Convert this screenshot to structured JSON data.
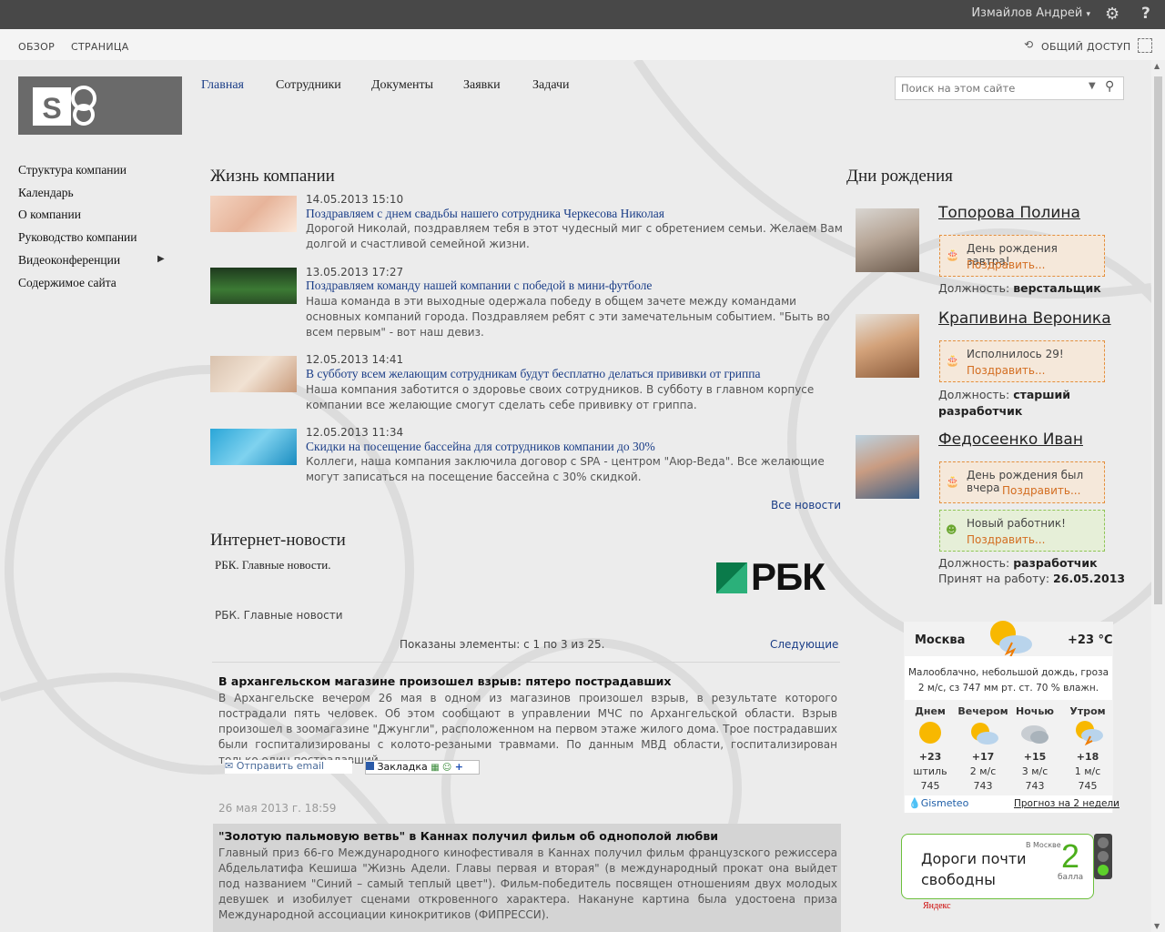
{
  "topbar": {
    "user_name": "Измайлов Андрей",
    "help": "?"
  },
  "ribbon": {
    "tab_browse": "ОБЗОР",
    "tab_page": "СТРАНИЦА",
    "share": "ОБЩИЙ ДОСТУП"
  },
  "topnav": [
    "Главная",
    "Сотрудники",
    "Документы",
    "Заявки",
    "Задачи"
  ],
  "search": {
    "placeholder": "Поиск на этом сайте"
  },
  "leftnav": [
    "Структура компании",
    "Календарь",
    "О компании",
    "Руководство компании",
    "Видеоконференции",
    "Содержимое сайта"
  ],
  "company": {
    "heading": "Жизнь компании",
    "news": [
      {
        "date": "14.05.2013 15:10",
        "title": "Поздравляем с днем свадьбы нашего сотрудника Черкесова Николая",
        "text": "Дорогой Николай, поздравляем тебя в этот чудесный миг с обретением семьи. Желаем Вам долгой и счастливой семейной жизни."
      },
      {
        "date": "13.05.2013 17:27",
        "title": "Поздравляем команду нашей компании с победой в мини-футболе",
        "text": "Наша команда в эти выходные одержала победу в общем зачете между командами основных компаний города. Поздравляем ребят с эти замечательным событием. \"Быть во всем первым\" - вот наш девиз."
      },
      {
        "date": "12.05.2013 14:41",
        "title": "В субботу всем желающим сотрудникам будут бесплатно делаться прививки от гриппа",
        "text": "Наша компания заботится о здоровье своих сотрудников. В субботу в главном корпусе компании все желающие смогут сделать себе прививку от гриппа."
      },
      {
        "date": "12.05.2013 11:34",
        "title": "Скидки на посещение бассейна для сотрудников компании до 30%",
        "text": "Коллеги, наша компания заключила договор с SPA - центром \"Аюр-Веда\". Все желающие могут записаться на посещение бассейна с 30% скидкой."
      }
    ],
    "all_news": "Все новости"
  },
  "internet": {
    "heading": "Интернет-новости",
    "source_title": "РБК. Главные новости.",
    "logo_text": "РБК",
    "feed_name": "РБК. Главные новости",
    "paging": "Показаны элементы: с 1 по 3 из 25.",
    "next": "Следующие",
    "items": [
      {
        "title": "В архангельском магазине произошел взрыв: пятеро пострадавших",
        "text": "В Архангельске вечером 26 мая в одном из магазинов произошел взрыв, в результате которого пострадали пять человек. Об этом сообщают в управлении МЧС по Архангельской области. Взрыв произошел в зоомагазине \"Джунгли\", расположенном на первом этаже жилого дома. Трое пострадавших были госпитализированы с колото-резаными травмами. По данным МВД области, госпитализирован только один пострадавший.",
        "email": "Отправить email",
        "bookmark": "Закладка"
      },
      {
        "date": "26 мая 2013 г. 18:59",
        "title": "\"Золотую пальмовую ветвь\" в Каннах получил фильм об однополой любви",
        "text": "Главный приз 66-го Международного кинофестиваля в Каннах получил фильм французского режиссера Абдельлатифа Кешиша \"Жизнь Адели. Главы первая и вторая\" (в международный прокат она выйдет под названием \"Синий – самый теплый цвет\"). Фильм-победитель посвящен отношениям двух молодых девушек и изобилует сценами откровенного характера. Накануне картина была удостоена приза Международной ассоциации кинокритиков (ФИПРЕССИ)."
      }
    ]
  },
  "birthdays": {
    "heading": "Дни рождения",
    "people": [
      {
        "name": "Топорова Полина",
        "note": "День рождения завтра!",
        "cong": "Поздравить...",
        "pos_label": "Должность:",
        "position": "верстальщик"
      },
      {
        "name": "Крапивина Вероника",
        "note": "Исполнилось 29!",
        "cong": "Поздравить...",
        "pos_label": "Должность:",
        "position": "старший разработчик"
      },
      {
        "name": "Федосеенко Иван",
        "note": "День рождения был вчера",
        "cong": "Поздравить...",
        "note2": "Новый работник!",
        "cong2": "Поздравить...",
        "pos_label": "Должность:",
        "position": "разработчик",
        "hired_label": "Принят на работу:",
        "hired": "26.05.2013"
      }
    ]
  },
  "weather": {
    "city": "Москва",
    "temp": "+23 °C",
    "desc": "Малооблачно, небольшой дождь, гроза",
    "details": "2 м/с, сз  747 мм рт. ст.  70 % влажн.",
    "periods": [
      {
        "name": "Днем",
        "t": "+23",
        "wind": "штиль",
        "p": "745"
      },
      {
        "name": "Вечером",
        "t": "+17",
        "wind": "2 м/с",
        "p": "743"
      },
      {
        "name": "Ночью",
        "t": "+15",
        "wind": "3 м/с",
        "p": "743"
      },
      {
        "name": "Утром",
        "t": "+18",
        "wind": "1 м/с",
        "p": "745"
      }
    ],
    "brand": "Gismeteo",
    "forecast_link": "Прогноз на 2 недели"
  },
  "traffic": {
    "text": "Дороги почти свободны",
    "city": "В Москве",
    "score": "2",
    "unit": "балла",
    "brand": "Яндекс"
  }
}
